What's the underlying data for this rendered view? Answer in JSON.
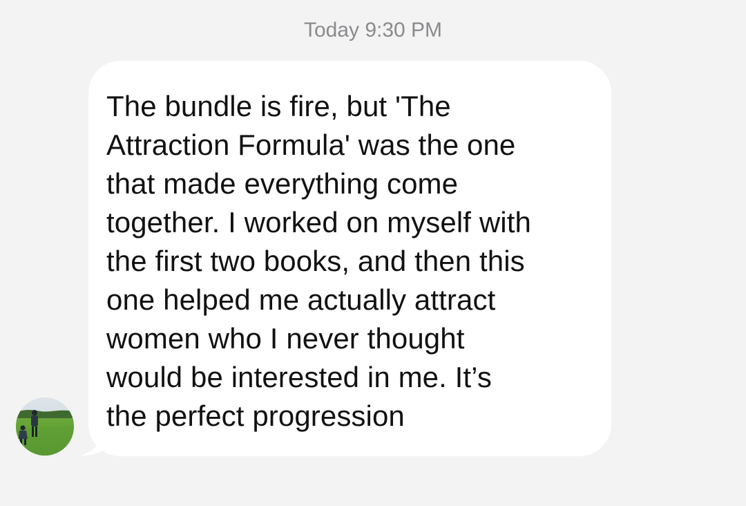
{
  "header": {
    "timestamp": "Today 9:30 PM"
  },
  "message": {
    "direction": "incoming",
    "text": "The bundle is fire, but 'The\nAttraction Formula' was the one\nthat made everything come\ntogether. I worked on myself with\nthe first two books, and then this\none helped me actually attract\nwomen who I never thought\nwould be interested in me. It’s\nthe perfect progression"
  },
  "avatar": {
    "icon": "sender-avatar-photo"
  },
  "colors": {
    "background": "#f3f3f3",
    "bubble": "#ffffff",
    "text": "#111111",
    "timestamp": "#8a8a8e"
  }
}
